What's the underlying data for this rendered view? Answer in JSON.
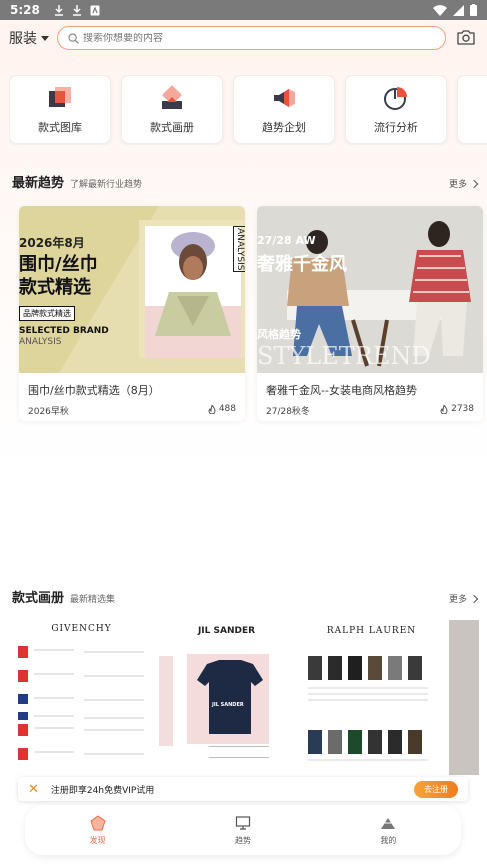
{
  "status_bar": {
    "time": "5:28"
  },
  "header": {
    "category": "服装",
    "search_placeholder": "搜索你想要的内容"
  },
  "quick_actions": [
    {
      "label": "款式图库",
      "icon": "gallery-icon"
    },
    {
      "label": "款式画册",
      "icon": "album-icon"
    },
    {
      "label": "趋势企划",
      "icon": "megaphone-icon"
    },
    {
      "label": "流行分析",
      "icon": "pie-chart-icon"
    }
  ],
  "trends": {
    "title": "最新趋势",
    "subtitle": "了解最新行业趋势",
    "more": "更多",
    "cards": [
      {
        "title": "围巾/丝巾款式精选（8月）",
        "season": "2026早秋",
        "views": "488",
        "thumb_year": "2026年8月",
        "thumb_line1": "围巾/丝巾",
        "thumb_line2": "款式精选",
        "thumb_tag": "品牌款式精选",
        "thumb_en1": "SELECTED BRAND",
        "thumb_en2": "ANALYSIS",
        "thumb_side": "ANALYSIS"
      },
      {
        "title": "奢雅千金风--女装电商风格趋势",
        "season": "27/28秋冬",
        "views": "2738",
        "thumb_season": "27/28 AW",
        "thumb_line1": "奢雅千金风",
        "thumb_tag": "风格趋势",
        "thumb_en": "STYLETREND"
      }
    ]
  },
  "albums": {
    "title": "款式画册",
    "subtitle": "最新精选集",
    "more": "更多",
    "items": [
      {
        "brand": "GIVENCHY"
      },
      {
        "brand": "JIL SANDER",
        "shirt_text": "JIL SANDER"
      },
      {
        "brand": "RALPH LAUREN"
      }
    ]
  },
  "vip_banner": {
    "text": "注册即享24h免费VIP试用",
    "button": "去注册"
  },
  "bottom_nav": [
    {
      "label": "发现",
      "active": true
    },
    {
      "label": "趋势",
      "active": false
    },
    {
      "label": "我的",
      "active": false
    }
  ],
  "colors": {
    "accent": "#f06c40",
    "search_border": "#f2a07b",
    "vip_button": "#f07d21"
  }
}
